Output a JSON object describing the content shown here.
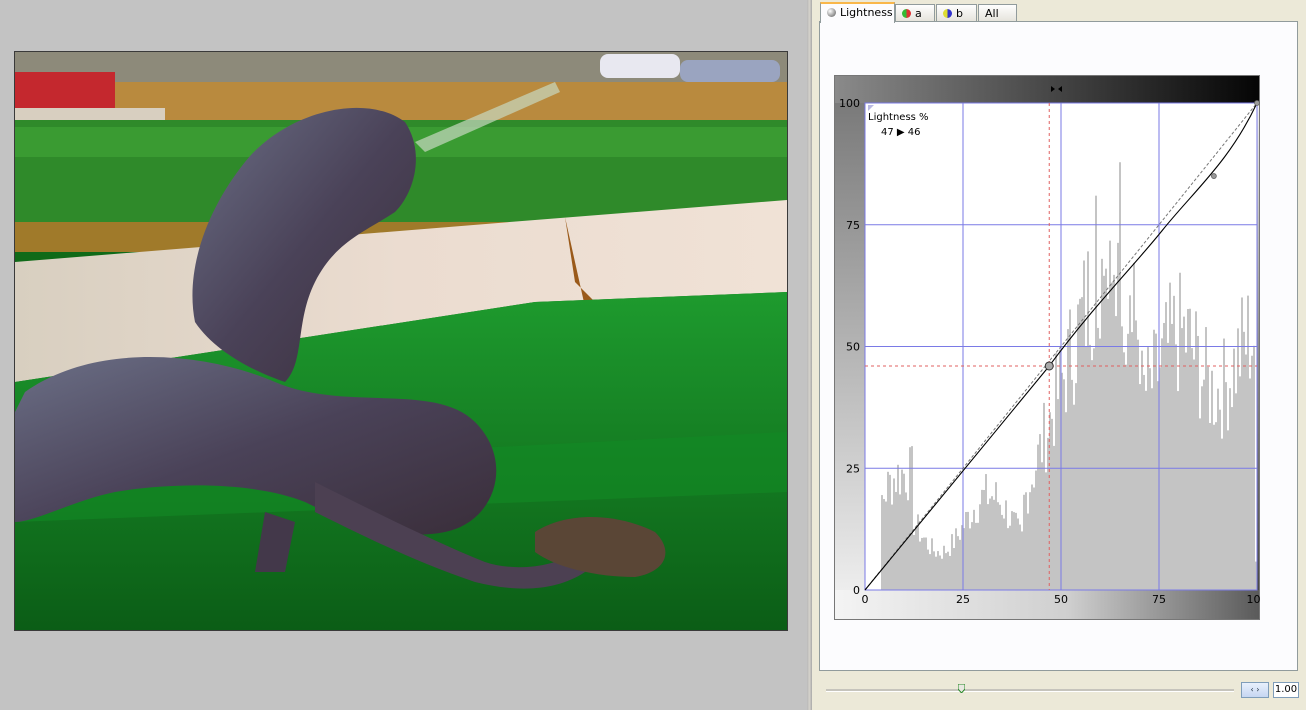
{
  "tabs": [
    {
      "label": "Lightness",
      "icon": "lightness-channel-icon",
      "active": true
    },
    {
      "label": "a",
      "icon": "a-channel-icon",
      "active": false
    },
    {
      "label": "b",
      "icon": "b-channel-icon",
      "active": false
    },
    {
      "label": "All",
      "icon": "",
      "active": false
    }
  ],
  "curve": {
    "readout_label": "Lightness %",
    "readout_value": "47 ▶ 46",
    "axis_ticks": [
      "0",
      "25",
      "50",
      "75",
      "100"
    ],
    "selected_point": {
      "input": 47,
      "output": 46
    }
  },
  "bottom": {
    "strength_value": "1.00",
    "spin_symbol": "‹ ›"
  },
  "colors": {
    "grid": "#7a7ae6",
    "histogram": "#c4c4c4",
    "crosshair": "#e06060",
    "active_tab_accent": "#f9b74a"
  }
}
